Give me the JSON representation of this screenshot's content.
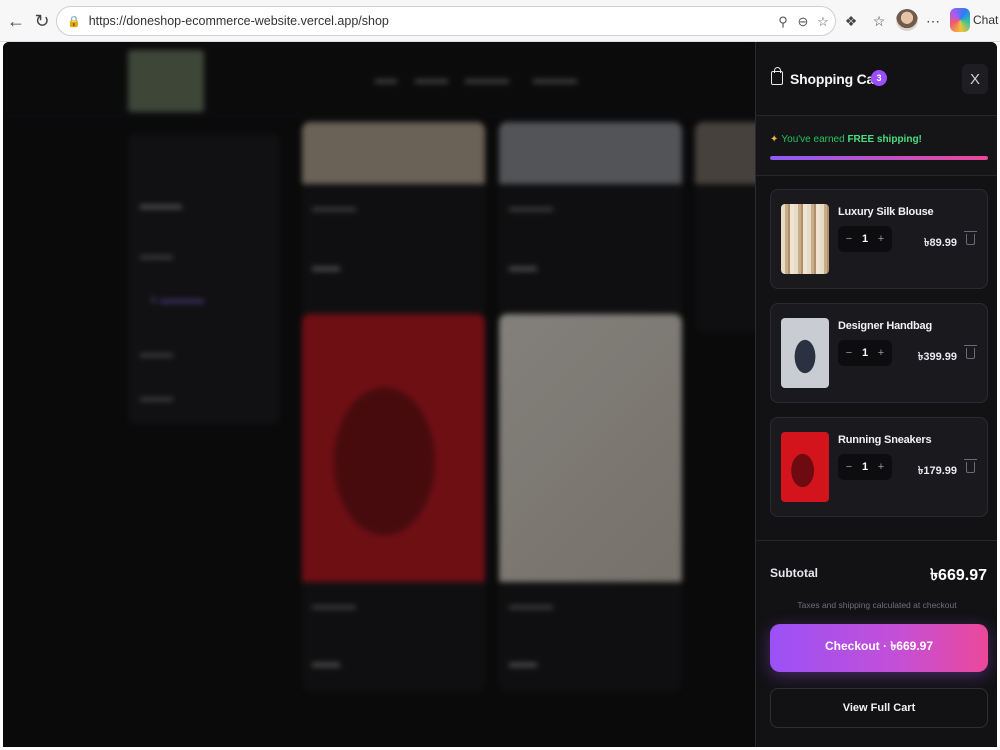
{
  "browser": {
    "url": "https://doneshop-ecommerce-website.vercel.app/shop",
    "chat_label": "Chat"
  },
  "cart": {
    "title": "Shopping Cart",
    "count": "3",
    "close_label": "X",
    "shipping_prefix": "You've earned ",
    "shipping_highlight": "FREE shipping!",
    "shipping_progress_percent": 100,
    "items": [
      {
        "name": "Luxury Silk Blouse",
        "qty": "1",
        "price": "৳89.99"
      },
      {
        "name": "Designer Handbag",
        "qty": "1",
        "price": "৳399.99"
      },
      {
        "name": "Running Sneakers",
        "qty": "1",
        "price": "৳179.99"
      }
    ],
    "subtotal_label": "Subtotal",
    "subtotal_value": "৳669.97",
    "tax_note": "Taxes and shipping calculated at checkout",
    "checkout_label": "Checkout · ৳669.97",
    "view_cart_label": "View Full Cart"
  },
  "colors": {
    "accent_purple": "#9b4dff",
    "accent_pink": "#ec4899",
    "shipping_green": "#22c55e",
    "drawer_bg": "#121215"
  }
}
